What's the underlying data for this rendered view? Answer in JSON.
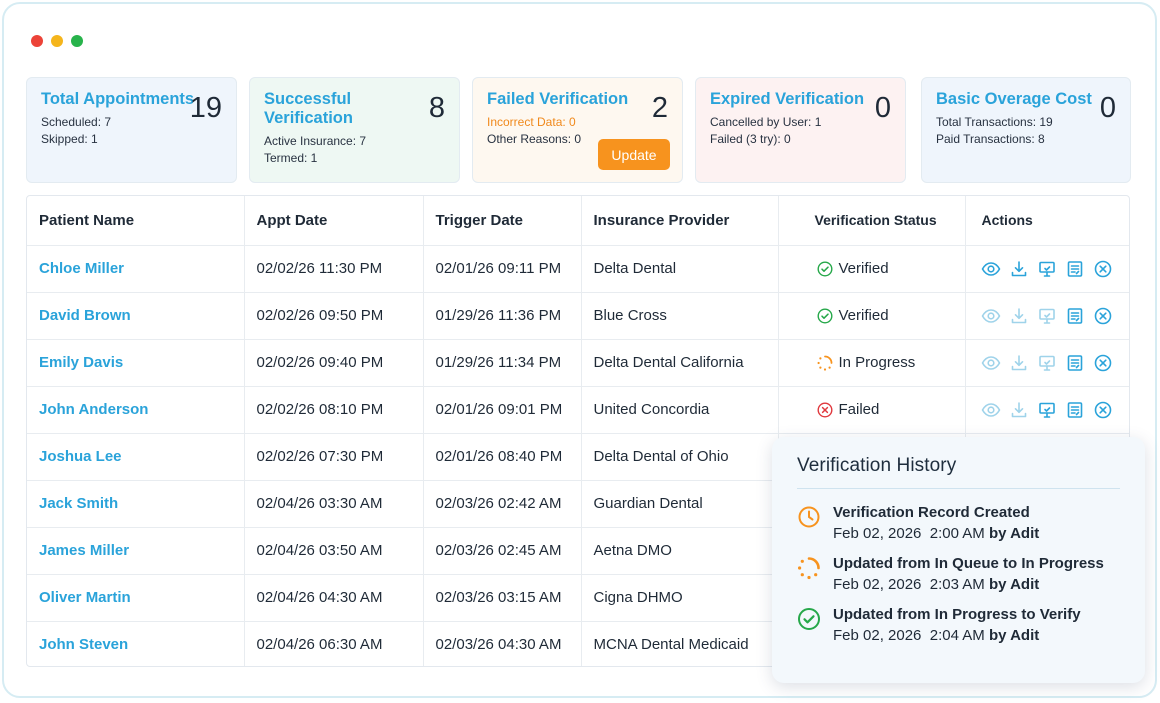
{
  "window": {
    "dot_colors": [
      "#ec4338",
      "#f5b51c",
      "#28b34b"
    ]
  },
  "cards": [
    {
      "title": "Total Appointments",
      "count": "19",
      "line1": "Scheduled: 7",
      "line2": "Skipped: 1",
      "bg": "#eff5fc"
    },
    {
      "title": "Successful Verification",
      "count": "8",
      "line1": "Active Insurance: 7",
      "line2": "Termed: 1",
      "bg": "#eef8f3"
    },
    {
      "title": "Failed Verification",
      "count": "2",
      "line1": "Incorrect Data: 0",
      "line2": "Other Reasons: 0",
      "button": "Update",
      "bg": "#fef8f0"
    },
    {
      "title": "Expired Verification",
      "count": "0",
      "line1": "Cancelled by User: 1",
      "line2": "Failed (3 try): 0",
      "bg": "#fdf2f2"
    },
    {
      "title": "Basic Overage Cost",
      "count": "0",
      "line1": "Total Transactions: 19",
      "line2": "Paid Transactions: 8",
      "bg": "#eff5fc"
    }
  ],
  "table": {
    "headers": [
      "Patient Name",
      "Appt Date",
      "Trigger Date",
      "Insurance Provider",
      "Verification Status",
      "Actions"
    ],
    "rows": [
      {
        "name": "Chloe Miller",
        "appt": "02/02/26 11:30 PM",
        "trigger": "02/01/26 09:11 PM",
        "provider": "Delta Dental",
        "status": "Verified",
        "status_type": "verified",
        "actions_enabled": true
      },
      {
        "name": "David Brown",
        "appt": "02/02/26 09:50 PM",
        "trigger": "01/29/26 11:36 PM",
        "provider": "Blue Cross",
        "status": "Verified",
        "status_type": "verified",
        "actions_enabled": false
      },
      {
        "name": "Emily Davis",
        "appt": "02/02/26 09:40 PM",
        "trigger": "01/29/26 11:34 PM",
        "provider": "Delta Dental California",
        "status": "In Progress",
        "status_type": "progress",
        "actions_enabled": false
      },
      {
        "name": "John Anderson",
        "appt": "02/02/26 08:10 PM",
        "trigger": "02/01/26 09:01 PM",
        "provider": "United Concordia",
        "status": "Failed",
        "status_type": "failed",
        "actions_enabled": false
      },
      {
        "name": "Joshua Lee",
        "appt": "02/02/26 07:30 PM",
        "trigger": "02/01/26 08:40 PM",
        "provider": "Delta Dental of Ohio",
        "status": "",
        "status_type": "",
        "actions_enabled": false
      },
      {
        "name": "Jack Smith",
        "appt": "02/04/26 03:30 AM",
        "trigger": "02/03/26 02:42 AM",
        "provider": "Guardian Dental",
        "status": "",
        "status_type": "",
        "actions_enabled": false
      },
      {
        "name": "James Miller",
        "appt": "02/04/26 03:50 AM",
        "trigger": "02/03/26 02:45 AM",
        "provider": "Aetna DMO",
        "status": "",
        "status_type": "",
        "actions_enabled": false
      },
      {
        "name": "Oliver Martin",
        "appt": "02/04/26 04:30 AM",
        "trigger": "02/03/26 03:15 AM",
        "provider": "Cigna DHMO",
        "status": "",
        "status_type": "",
        "actions_enabled": false
      },
      {
        "name": "John Steven",
        "appt": "02/04/26 06:30 AM",
        "trigger": "02/03/26 04:30 AM",
        "provider": "MCNA Dental Medicaid",
        "status": "",
        "status_type": "",
        "actions_enabled": false
      }
    ],
    "action_icons": [
      "eye-icon",
      "download-icon",
      "monitor-icon",
      "notes-icon",
      "cancel-circle-icon"
    ]
  },
  "history": {
    "title": "Verification History",
    "items": [
      {
        "title": "Verification Record Created",
        "date": "Feb 02, 2026  2:00 AM",
        "by": "by Adit",
        "icon": "clock-icon"
      },
      {
        "title": "Updated from In Queue to In Progress",
        "date": "Feb 02, 2026  2:03 AM",
        "by": "by Adit",
        "icon": "progress-icon"
      },
      {
        "title": "Updated from In Progress to Verify",
        "date": "Feb 02, 2026  2:04 AM",
        "by": "by Adit",
        "icon": "check-circle-icon"
      }
    ]
  },
  "colors": {
    "accent": "#2aa3da",
    "verified": "#26a84a",
    "progress": "#f7931e",
    "failed": "#e0393e",
    "action_enabled": "#2aa3da",
    "action_disabled": "#9fd3ea"
  }
}
